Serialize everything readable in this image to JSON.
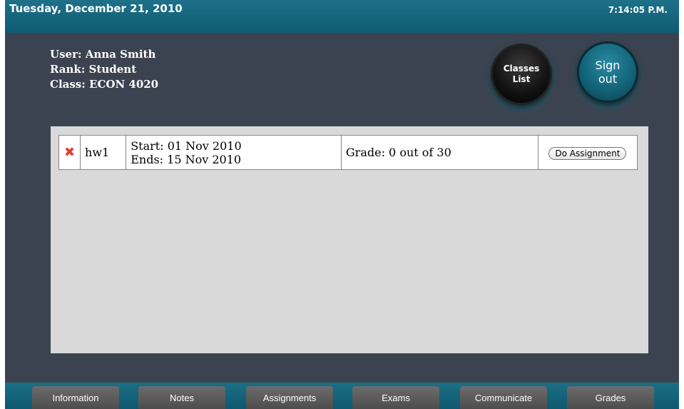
{
  "header": {
    "date": "Tuesday, December 21, 2010",
    "time": "7:14:05 P.M."
  },
  "user": {
    "user_line": "User: Anna Smith",
    "rank_line": "Rank: Student",
    "class_line": "Class: ECON 4020"
  },
  "buttons": {
    "classes_list": "Classes List",
    "sign_out": "Sign out"
  },
  "assignments": [
    {
      "name": "hw1",
      "start": "Start: 01 Nov 2010",
      "ends": "Ends: 15 Nov 2010",
      "grade": "Grade: 0 out of 30",
      "action": "Do Assignment",
      "delete_icon": "close-icon",
      "delete_color": "#e23b2e"
    }
  ],
  "nav": {
    "tabs": [
      "Information",
      "Notes",
      "Assignments",
      "Exams",
      "Communicate",
      "Grades"
    ]
  },
  "colors": {
    "topbar": "#1d7189",
    "background": "#3c4350",
    "panel": "#d9d9d9"
  }
}
